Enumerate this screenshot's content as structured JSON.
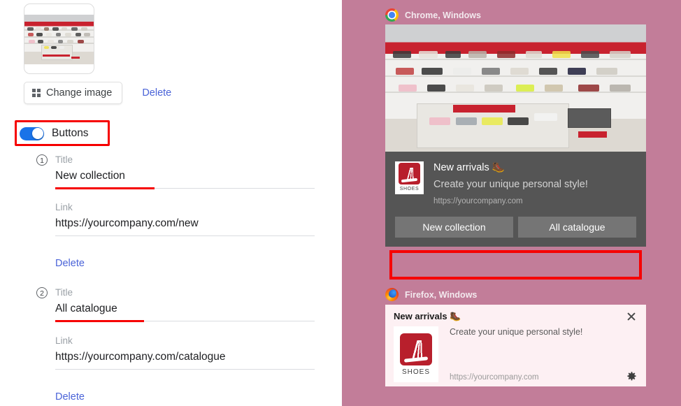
{
  "editor": {
    "image": {
      "alt": "shoe-store-interior-thumbnail",
      "change_label": "Change image",
      "delete_label": "Delete"
    },
    "toggle": {
      "label": "Buttons",
      "state": "on",
      "accent_color": "#1a73e8",
      "highlight_color": "#f60000"
    },
    "buttons": [
      {
        "index": "1",
        "title_label": "Title",
        "title_value": "New collection",
        "title_focused": true,
        "link_label": "Link",
        "link_value": "https://yourcompany.com/new",
        "delete_label": "Delete"
      },
      {
        "index": "2",
        "title_label": "Title",
        "title_value": "All catalogue",
        "title_focused": true,
        "link_label": "Link",
        "link_value": "https://yourcompany.com/catalogue",
        "delete_label": "Delete"
      }
    ]
  },
  "preview": {
    "background_color": "#c27d99",
    "chrome": {
      "os_label": "Chrome, Windows",
      "icon": "chrome-icon",
      "notification": {
        "hero_alt": "shoe-store-interior-hero",
        "app_icon_text": "SHOES",
        "title": "New arrivals 🥾",
        "description": "Create your unique personal style!",
        "url": "https://yourcompany.com",
        "actions": [
          "New collection",
          "All catalogue"
        ],
        "highlight_color": "#f60000",
        "body_color": "#555555",
        "action_color": "#757575"
      }
    },
    "firefox": {
      "os_label": "Firefox, Windows",
      "icon": "firefox-icon",
      "notification": {
        "title": "New arrivals 🥾",
        "description": "Create your unique personal style!",
        "url": "https://yourcompany.com",
        "app_icon_text": "SHOES",
        "close_icon": "close-icon",
        "settings_icon": "gear-icon",
        "body_color": "#fdf0f3"
      }
    }
  }
}
